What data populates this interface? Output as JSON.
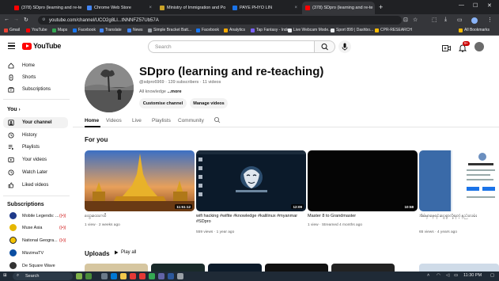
{
  "browser": {
    "tabs": [
      {
        "title": "(378) SDpro (learning and re-te",
        "fav_color": "#ff0000",
        "active": false
      },
      {
        "title": "Chrome Web Store",
        "fav_color": "#4285f4",
        "active": false
      },
      {
        "title": "Ministry of Immigration and Po",
        "fav_color": "#c9a227",
        "active": false
      },
      {
        "title": "PAYE PHYO LIN",
        "fav_color": "#1a73e8",
        "active": false
      },
      {
        "title": "(378) SDpro (learning and re-te",
        "fav_color": "#ff0000",
        "active": true
      }
    ],
    "new_tab_label": "+",
    "url": "youtube.com/channel/UCO2g8Ll...tNNNFZ57Ub57A",
    "bookmarks": [
      {
        "label": "Gmail",
        "color": "#ea4335"
      },
      {
        "label": "YouTube",
        "color": "#ff0000"
      },
      {
        "label": "Maps",
        "color": "#34a853"
      },
      {
        "label": "Facebook",
        "color": "#1877f2"
      },
      {
        "label": "Translate",
        "color": "#4285f4"
      },
      {
        "label": "News",
        "color": "#4285f4"
      },
      {
        "label": "Simple Bracket Batt...",
        "color": "#9aa0a6"
      },
      {
        "label": "Facebook",
        "color": "#1877f2"
      },
      {
        "label": "Analytics",
        "color": "#f9ab00"
      },
      {
        "label": "Tap Fantasy - Index",
        "color": "#7b61ff"
      },
      {
        "label": "Live Webcam Mode...",
        "color": "#e8eaed"
      },
      {
        "label": "Sport 899 | Dashbo...",
        "color": "#e8eaed"
      },
      {
        "label": "CPR-RESEARCH",
        "color": "#fbbc04"
      }
    ],
    "all_bookmarks_label": "All Bookmarks"
  },
  "masthead": {
    "logo_text": "YouTube",
    "search_placeholder": "Search",
    "notification_count": "9+"
  },
  "sidebar": {
    "main_items": [
      {
        "label": "Home",
        "icon": "home-icon"
      },
      {
        "label": "Shorts",
        "icon": "shorts-icon"
      },
      {
        "label": "Subscriptions",
        "icon": "subscriptions-icon"
      }
    ],
    "you_heading": "You",
    "you_items": [
      {
        "label": "Your channel",
        "icon": "your-channel-icon",
        "active": true
      },
      {
        "label": "History",
        "icon": "history-icon"
      },
      {
        "label": "Playlists",
        "icon": "playlists-icon"
      },
      {
        "label": "Your videos",
        "icon": "your-videos-icon"
      },
      {
        "label": "Watch Later",
        "icon": "watch-later-icon"
      },
      {
        "label": "Liked videos",
        "icon": "liked-videos-icon"
      }
    ],
    "subscriptions_heading": "Subscriptions",
    "subscriptions": [
      {
        "label": "Mobile Legends: ...",
        "color": "#1e3a8a",
        "live": true
      },
      {
        "label": "Muse Asia",
        "color": "#e5b700",
        "live": true
      },
      {
        "label": "National Geogra...",
        "color": "#f5c400",
        "live": true
      },
      {
        "label": "MizzimaTV",
        "color": "#0b4ea2",
        "live": false
      },
      {
        "label": "De Square Wave",
        "color": "#333333",
        "live": false
      }
    ]
  },
  "channel": {
    "name": "SDpro (learning and re-teaching)",
    "handle_meta": "@sdpro6969 · 139 subscribers · 11 videos",
    "description": "All knowledge",
    "more_label": "...more",
    "customise_label": "Customise channel",
    "manage_label": "Manage videos",
    "tabs": [
      "Home",
      "Videos",
      "Live",
      "Playlists",
      "Community"
    ]
  },
  "for_you": {
    "heading": "For you",
    "videos": [
      {
        "title": "ထွေးထေးကဝိ",
        "meta": "1 view · 2 weeks ago",
        "duration": "11:51:12"
      },
      {
        "title": "wifi hacking #wifite #knowledge #kalilinux #myanmar #SDpro",
        "meta": "559 views · 1 year ago",
        "duration": "12:09"
      },
      {
        "title": "Master 8 to Grandmaster",
        "meta": "1 view · Streamed 4 months ago",
        "duration": "10:58"
      },
      {
        "title": "အိမ်မှာနေရင်းငွေရှာလို့ရတဲ့ နည်းလမ်း",
        "meta": "65 views · 4 years ago",
        "duration": ""
      }
    ]
  },
  "uploads": {
    "heading": "Uploads",
    "play_all_label": "Play all"
  },
  "taskbar": {
    "search_label": "Search",
    "clock": "11:30 PM"
  }
}
